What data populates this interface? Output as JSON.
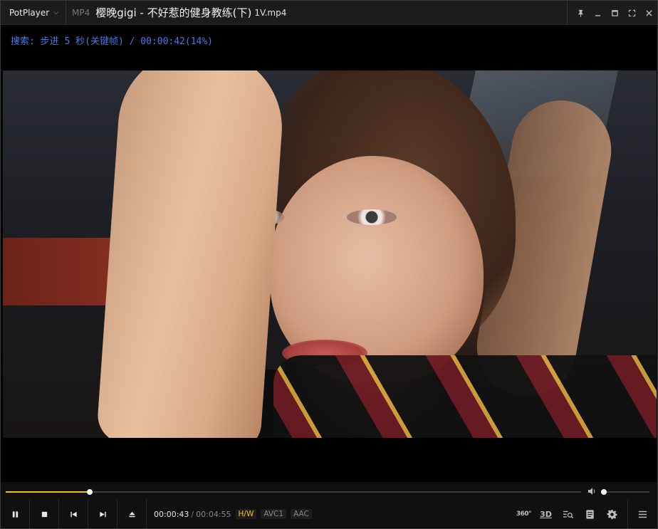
{
  "titlebar": {
    "app_name": "PotPlayer",
    "format": "MP4",
    "title": "樱晚gigi - 不好惹的健身教练(下)",
    "file_suffix": "1V.mp4"
  },
  "osd": {
    "message": "搜索: 步进 5 秒(关键帧) / 00:00:42(14%)"
  },
  "playback": {
    "current_time": "00:00:43",
    "total_time": "00:04:55",
    "progress": 0.146,
    "volume": 0.06,
    "tags": [
      "H/W",
      "AVC1",
      "AAC"
    ]
  },
  "right_controls": {
    "vr_label": "360°",
    "threed_label": "3D"
  },
  "colors": {
    "accent": "#f2c020",
    "osd_text": "#4a78e8",
    "background": "#000000",
    "panel": "#101010"
  }
}
